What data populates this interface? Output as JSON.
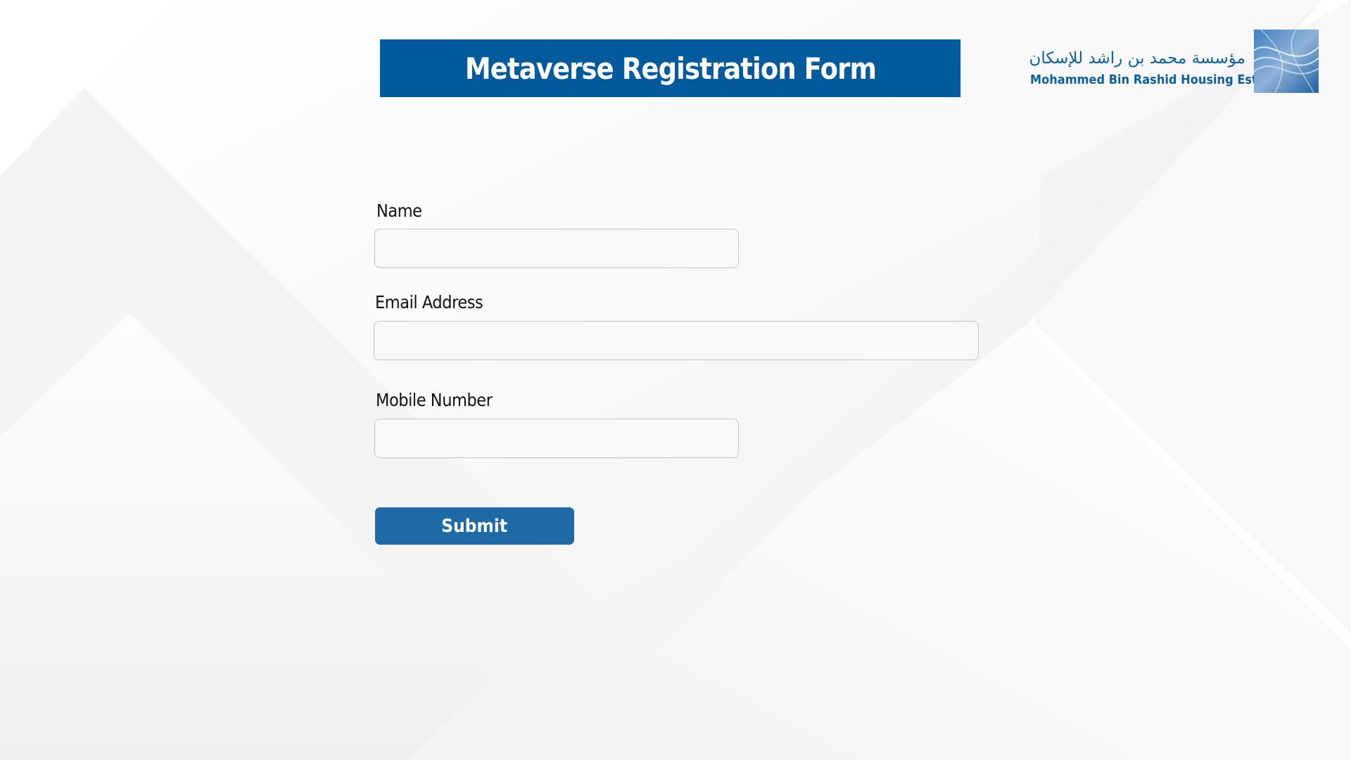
{
  "header": {
    "title": "Metaverse Registration Form",
    "banner_color": "#035a9c"
  },
  "logo": {
    "arabic_name": "مؤسسة محمد بن راشد للإسكان",
    "english_name": "Mohammed Bin Rashid Housing Est.",
    "brand_color": "#0e5f9e"
  },
  "form": {
    "fields": [
      {
        "label": "Name",
        "value": "",
        "placeholder": ""
      },
      {
        "label": "Email Address",
        "value": "",
        "placeholder": ""
      },
      {
        "label": "Mobile Number",
        "value": "",
        "placeholder": ""
      }
    ],
    "submit_label": "Submit",
    "submit_color": "#1d6aa6"
  }
}
